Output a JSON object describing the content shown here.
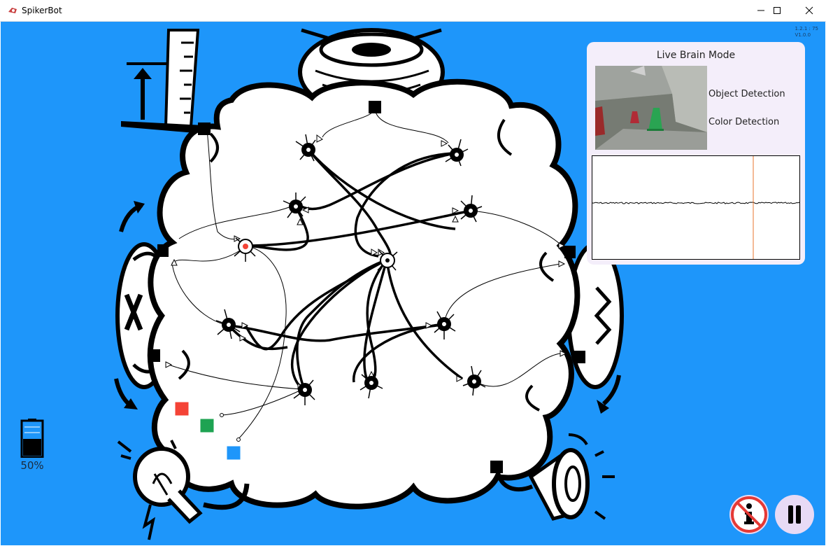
{
  "window": {
    "title": "SpikerBot",
    "controls": [
      "minimize-icon",
      "maximize-icon",
      "close-icon"
    ]
  },
  "version": {
    "line1": "1.2.1 : 75",
    "line2": "V1.0.0"
  },
  "live_panel": {
    "title": "Live Brain Mode",
    "options": [
      "Object Detection",
      "Color Detection"
    ]
  },
  "battery": {
    "label": "50%",
    "level": 0.5
  },
  "color_inputs": [
    {
      "name": "red",
      "color": "#f44336"
    },
    {
      "name": "green",
      "color": "#1ea352"
    },
    {
      "name": "blue",
      "color": "#1e96fa"
    }
  ],
  "colors": {
    "background": "#1e96fa",
    "panel": "#f4eefa",
    "trace_marker": "#e8752c",
    "button": "#e7daf5"
  },
  "buttons": {
    "info": "info-icon",
    "pause": "pause-icon"
  }
}
